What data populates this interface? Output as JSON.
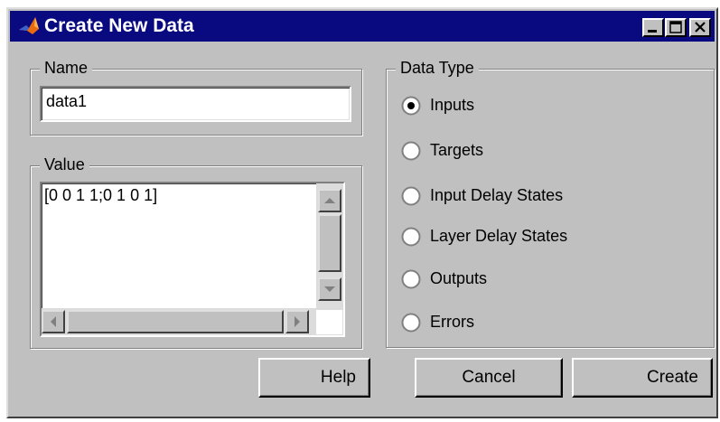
{
  "window": {
    "title": "Create New Data",
    "controls": [
      "minimize-icon",
      "maximize-icon",
      "close-icon"
    ]
  },
  "name_group": {
    "legend": "Name",
    "value": "data1"
  },
  "value_group": {
    "legend": "Value",
    "value": "[0 0 1 1;0 1 0 1]"
  },
  "data_type_group": {
    "legend": "Data Type",
    "selected": "Inputs",
    "options": [
      "Inputs",
      "Targets",
      "Input Delay States",
      "Layer Delay States",
      "Outputs",
      "Errors"
    ]
  },
  "buttons": {
    "help": "Help",
    "cancel": "Cancel",
    "create": "Create"
  },
  "colors": {
    "titlebar": "#0a0a80",
    "face": "#c0c0c0"
  }
}
